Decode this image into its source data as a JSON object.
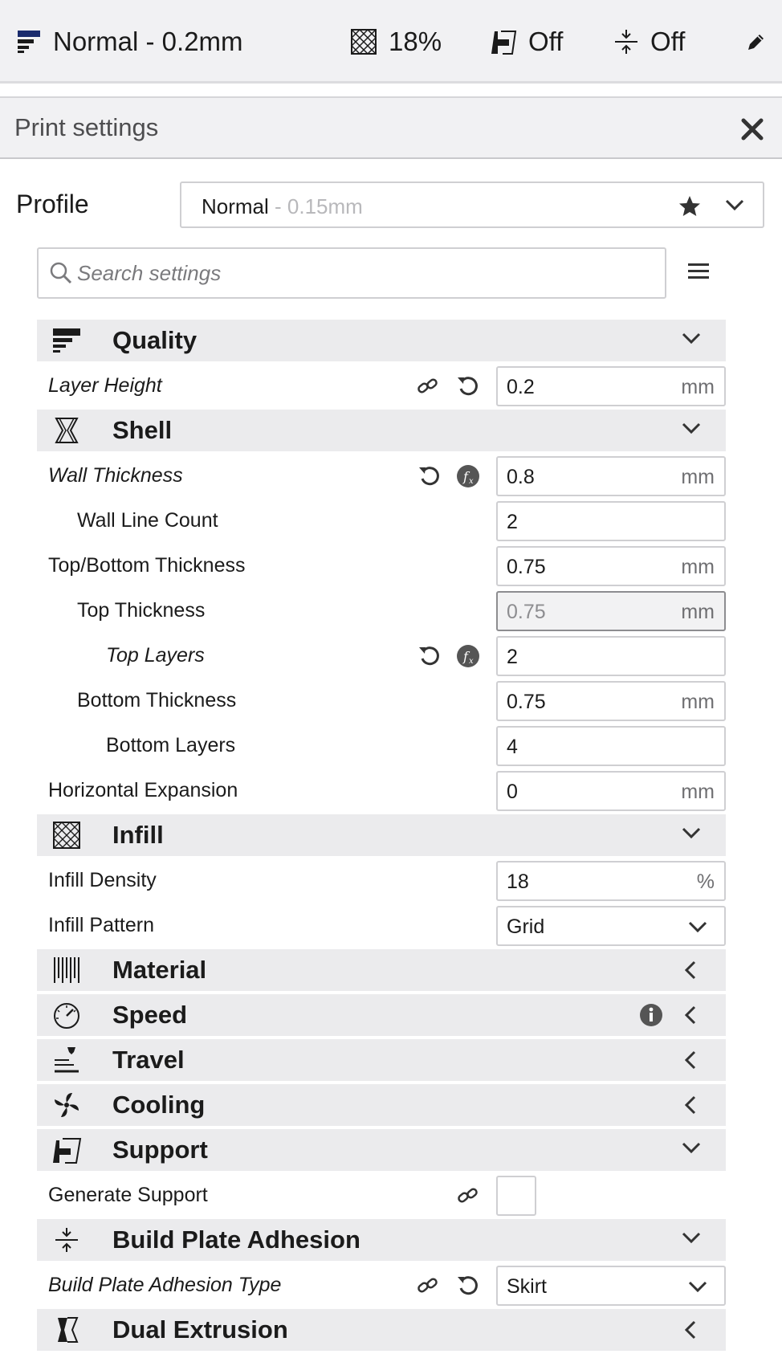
{
  "topbar": {
    "profile": "Normal - 0.2mm",
    "infill": "18%",
    "support": "Off",
    "adhesion": "Off"
  },
  "panel": {
    "title": "Print settings",
    "profile_label": "Profile",
    "profile_name": "Normal",
    "profile_sub": " - 0.15mm",
    "search_placeholder": "Search settings"
  },
  "settings": {
    "quality": {
      "label": "Quality",
      "layer_height": {
        "label": "Layer Height",
        "value": "0.2",
        "unit": "mm"
      }
    },
    "shell": {
      "label": "Shell",
      "wall_thickness": {
        "label": "Wall Thickness",
        "value": "0.8",
        "unit": "mm"
      },
      "wall_line_count": {
        "label": "Wall Line Count",
        "value": "2"
      },
      "top_bottom_thickness": {
        "label": "Top/Bottom Thickness",
        "value": "0.75",
        "unit": "mm"
      },
      "top_thickness": {
        "label": "Top Thickness",
        "value": "0.75",
        "unit": "mm"
      },
      "top_layers": {
        "label": "Top Layers",
        "value": "2"
      },
      "bottom_thickness": {
        "label": "Bottom Thickness",
        "value": "0.75",
        "unit": "mm"
      },
      "bottom_layers": {
        "label": "Bottom Layers",
        "value": "4"
      },
      "horizontal_expansion": {
        "label": "Horizontal Expansion",
        "value": "0",
        "unit": "mm"
      }
    },
    "infill": {
      "label": "Infill",
      "density": {
        "label": "Infill Density",
        "value": "18",
        "unit": "%"
      },
      "pattern": {
        "label": "Infill Pattern",
        "value": "Grid"
      }
    },
    "material": {
      "label": "Material"
    },
    "speed": {
      "label": "Speed"
    },
    "travel": {
      "label": "Travel"
    },
    "cooling": {
      "label": "Cooling"
    },
    "support": {
      "label": "Support",
      "generate": {
        "label": "Generate Support"
      }
    },
    "adhesion": {
      "label": "Build Plate Adhesion",
      "type": {
        "label": "Build Plate Adhesion Type",
        "value": "Skirt"
      }
    },
    "dual_extrusion": {
      "label": "Dual Extrusion"
    }
  }
}
